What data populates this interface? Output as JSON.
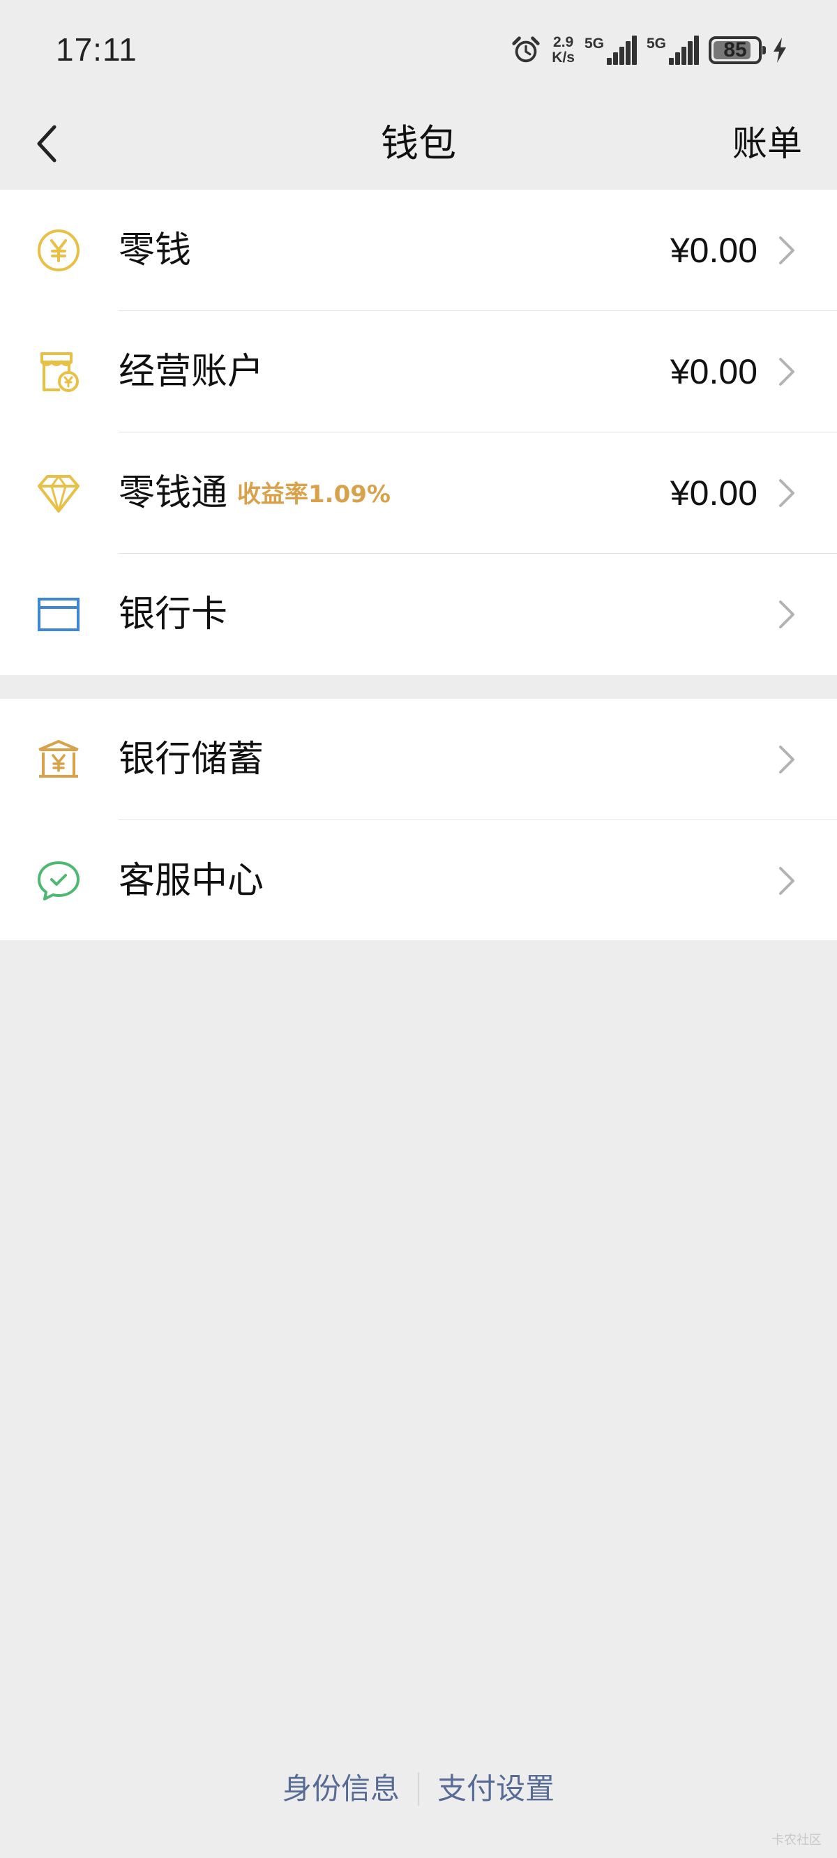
{
  "status_bar": {
    "time": "17:11",
    "net_speed_value": "2.9",
    "net_speed_unit": "K/s",
    "sim1_label": "5G",
    "sim2_label": "5G",
    "battery": "85",
    "battery_level": 0.85,
    "icons": [
      "alarm-icon",
      "signal-icon",
      "battery-icon",
      "charging-icon"
    ]
  },
  "nav": {
    "title": "钱包",
    "right_action": "账单",
    "back_icon": "chevron-left-icon"
  },
  "groups": [
    {
      "items": [
        {
          "label": "零钱",
          "tag": "",
          "value": "¥0.00",
          "icon": "coin-yen-icon",
          "color": "#e9c046"
        },
        {
          "label": "经营账户",
          "tag": "",
          "value": "¥0.00",
          "icon": "shop-account-icon",
          "color": "#e9c046"
        },
        {
          "label": "零钱通",
          "tag": "收益率1.09%",
          "value": "¥0.00",
          "icon": "diamond-icon",
          "color": "#e9c046"
        },
        {
          "label": "银行卡",
          "tag": "",
          "value": "",
          "icon": "bank-card-icon",
          "color": "#3e87d6"
        }
      ]
    },
    {
      "items": [
        {
          "label": "银行储蓄",
          "tag": "",
          "value": "",
          "icon": "bank-building-icon",
          "color": "#d9a24a"
        },
        {
          "label": "客服中心",
          "tag": "",
          "value": "",
          "icon": "customer-service-icon",
          "color": "#4db870"
        }
      ]
    }
  ],
  "footer": {
    "identity": "身份信息",
    "payment_settings": "支付设置"
  },
  "watermark": "卡农社区",
  "colors": {
    "background": "#ededed",
    "card": "#ffffff",
    "link": "#576b95",
    "tag": "#d9a24a"
  }
}
